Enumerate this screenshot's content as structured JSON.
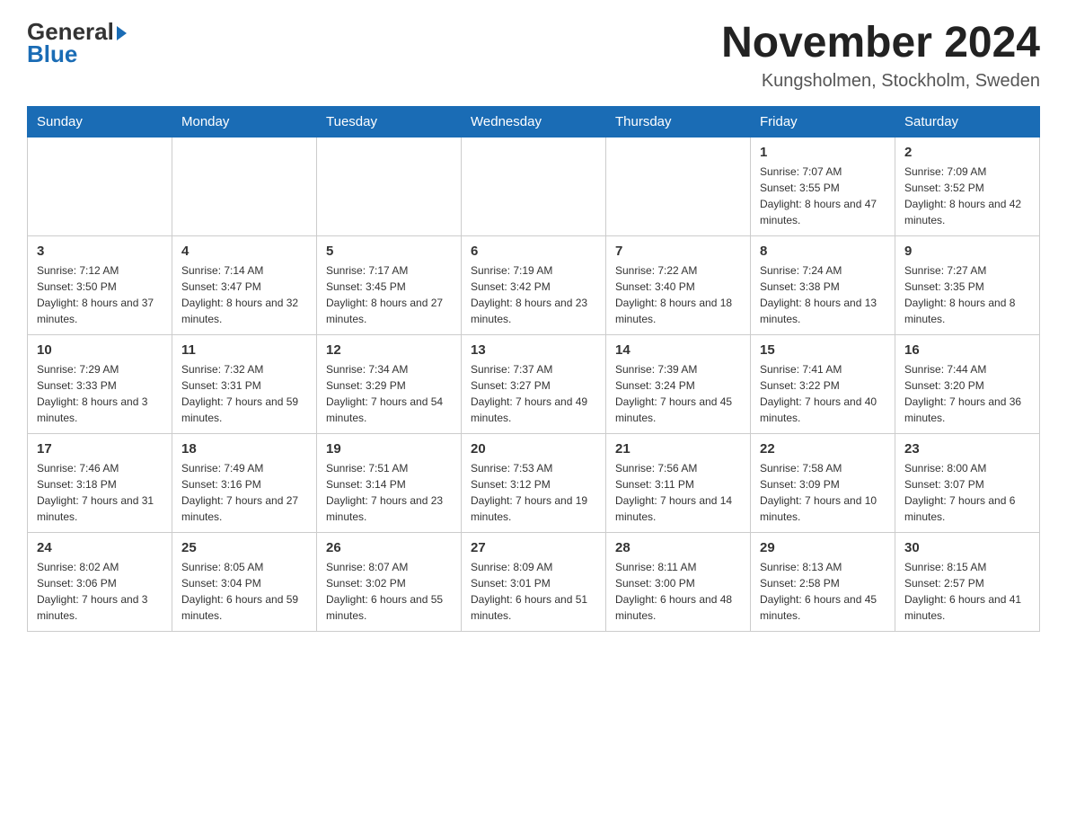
{
  "header": {
    "logo_general": "General",
    "logo_blue": "Blue",
    "title": "November 2024",
    "subtitle": "Kungsholmen, Stockholm, Sweden"
  },
  "days_of_week": [
    "Sunday",
    "Monday",
    "Tuesday",
    "Wednesday",
    "Thursday",
    "Friday",
    "Saturday"
  ],
  "weeks": [
    [
      {
        "num": "",
        "sunrise": "",
        "sunset": "",
        "daylight": ""
      },
      {
        "num": "",
        "sunrise": "",
        "sunset": "",
        "daylight": ""
      },
      {
        "num": "",
        "sunrise": "",
        "sunset": "",
        "daylight": ""
      },
      {
        "num": "",
        "sunrise": "",
        "sunset": "",
        "daylight": ""
      },
      {
        "num": "",
        "sunrise": "",
        "sunset": "",
        "daylight": ""
      },
      {
        "num": "1",
        "sunrise": "Sunrise: 7:07 AM",
        "sunset": "Sunset: 3:55 PM",
        "daylight": "Daylight: 8 hours and 47 minutes."
      },
      {
        "num": "2",
        "sunrise": "Sunrise: 7:09 AM",
        "sunset": "Sunset: 3:52 PM",
        "daylight": "Daylight: 8 hours and 42 minutes."
      }
    ],
    [
      {
        "num": "3",
        "sunrise": "Sunrise: 7:12 AM",
        "sunset": "Sunset: 3:50 PM",
        "daylight": "Daylight: 8 hours and 37 minutes."
      },
      {
        "num": "4",
        "sunrise": "Sunrise: 7:14 AM",
        "sunset": "Sunset: 3:47 PM",
        "daylight": "Daylight: 8 hours and 32 minutes."
      },
      {
        "num": "5",
        "sunrise": "Sunrise: 7:17 AM",
        "sunset": "Sunset: 3:45 PM",
        "daylight": "Daylight: 8 hours and 27 minutes."
      },
      {
        "num": "6",
        "sunrise": "Sunrise: 7:19 AM",
        "sunset": "Sunset: 3:42 PM",
        "daylight": "Daylight: 8 hours and 23 minutes."
      },
      {
        "num": "7",
        "sunrise": "Sunrise: 7:22 AM",
        "sunset": "Sunset: 3:40 PM",
        "daylight": "Daylight: 8 hours and 18 minutes."
      },
      {
        "num": "8",
        "sunrise": "Sunrise: 7:24 AM",
        "sunset": "Sunset: 3:38 PM",
        "daylight": "Daylight: 8 hours and 13 minutes."
      },
      {
        "num": "9",
        "sunrise": "Sunrise: 7:27 AM",
        "sunset": "Sunset: 3:35 PM",
        "daylight": "Daylight: 8 hours and 8 minutes."
      }
    ],
    [
      {
        "num": "10",
        "sunrise": "Sunrise: 7:29 AM",
        "sunset": "Sunset: 3:33 PM",
        "daylight": "Daylight: 8 hours and 3 minutes."
      },
      {
        "num": "11",
        "sunrise": "Sunrise: 7:32 AM",
        "sunset": "Sunset: 3:31 PM",
        "daylight": "Daylight: 7 hours and 59 minutes."
      },
      {
        "num": "12",
        "sunrise": "Sunrise: 7:34 AM",
        "sunset": "Sunset: 3:29 PM",
        "daylight": "Daylight: 7 hours and 54 minutes."
      },
      {
        "num": "13",
        "sunrise": "Sunrise: 7:37 AM",
        "sunset": "Sunset: 3:27 PM",
        "daylight": "Daylight: 7 hours and 49 minutes."
      },
      {
        "num": "14",
        "sunrise": "Sunrise: 7:39 AM",
        "sunset": "Sunset: 3:24 PM",
        "daylight": "Daylight: 7 hours and 45 minutes."
      },
      {
        "num": "15",
        "sunrise": "Sunrise: 7:41 AM",
        "sunset": "Sunset: 3:22 PM",
        "daylight": "Daylight: 7 hours and 40 minutes."
      },
      {
        "num": "16",
        "sunrise": "Sunrise: 7:44 AM",
        "sunset": "Sunset: 3:20 PM",
        "daylight": "Daylight: 7 hours and 36 minutes."
      }
    ],
    [
      {
        "num": "17",
        "sunrise": "Sunrise: 7:46 AM",
        "sunset": "Sunset: 3:18 PM",
        "daylight": "Daylight: 7 hours and 31 minutes."
      },
      {
        "num": "18",
        "sunrise": "Sunrise: 7:49 AM",
        "sunset": "Sunset: 3:16 PM",
        "daylight": "Daylight: 7 hours and 27 minutes."
      },
      {
        "num": "19",
        "sunrise": "Sunrise: 7:51 AM",
        "sunset": "Sunset: 3:14 PM",
        "daylight": "Daylight: 7 hours and 23 minutes."
      },
      {
        "num": "20",
        "sunrise": "Sunrise: 7:53 AM",
        "sunset": "Sunset: 3:12 PM",
        "daylight": "Daylight: 7 hours and 19 minutes."
      },
      {
        "num": "21",
        "sunrise": "Sunrise: 7:56 AM",
        "sunset": "Sunset: 3:11 PM",
        "daylight": "Daylight: 7 hours and 14 minutes."
      },
      {
        "num": "22",
        "sunrise": "Sunrise: 7:58 AM",
        "sunset": "Sunset: 3:09 PM",
        "daylight": "Daylight: 7 hours and 10 minutes."
      },
      {
        "num": "23",
        "sunrise": "Sunrise: 8:00 AM",
        "sunset": "Sunset: 3:07 PM",
        "daylight": "Daylight: 7 hours and 6 minutes."
      }
    ],
    [
      {
        "num": "24",
        "sunrise": "Sunrise: 8:02 AM",
        "sunset": "Sunset: 3:06 PM",
        "daylight": "Daylight: 7 hours and 3 minutes."
      },
      {
        "num": "25",
        "sunrise": "Sunrise: 8:05 AM",
        "sunset": "Sunset: 3:04 PM",
        "daylight": "Daylight: 6 hours and 59 minutes."
      },
      {
        "num": "26",
        "sunrise": "Sunrise: 8:07 AM",
        "sunset": "Sunset: 3:02 PM",
        "daylight": "Daylight: 6 hours and 55 minutes."
      },
      {
        "num": "27",
        "sunrise": "Sunrise: 8:09 AM",
        "sunset": "Sunset: 3:01 PM",
        "daylight": "Daylight: 6 hours and 51 minutes."
      },
      {
        "num": "28",
        "sunrise": "Sunrise: 8:11 AM",
        "sunset": "Sunset: 3:00 PM",
        "daylight": "Daylight: 6 hours and 48 minutes."
      },
      {
        "num": "29",
        "sunrise": "Sunrise: 8:13 AM",
        "sunset": "Sunset: 2:58 PM",
        "daylight": "Daylight: 6 hours and 45 minutes."
      },
      {
        "num": "30",
        "sunrise": "Sunrise: 8:15 AM",
        "sunset": "Sunset: 2:57 PM",
        "daylight": "Daylight: 6 hours and 41 minutes."
      }
    ]
  ]
}
